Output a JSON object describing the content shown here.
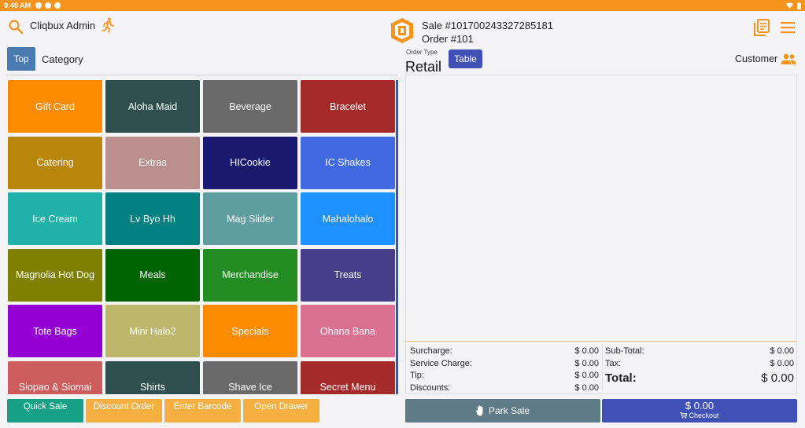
{
  "status": {
    "time": "9:48 AM"
  },
  "header": {
    "user_name": "Cliqbux Admin",
    "sale_number": "Sale #101700243327285181",
    "order_number": "Order #101"
  },
  "categories": {
    "top_label": "Top",
    "title": "Category",
    "tiles": [
      {
        "label": "Gift Card",
        "color": "#ff8c00"
      },
      {
        "label": "Aloha Maid",
        "color": "#2f4f4f"
      },
      {
        "label": "Beverage",
        "color": "#696969"
      },
      {
        "label": "Bracelet",
        "color": "#a52a2a"
      },
      {
        "label": "Catering",
        "color": "#b8860b"
      },
      {
        "label": "Extras",
        "color": "#bc8f8f"
      },
      {
        "label": "HICookie",
        "color": "#191970"
      },
      {
        "label": "IC Shakes",
        "color": "#4169e1"
      },
      {
        "label": "Ice Cream",
        "color": "#20b2aa"
      },
      {
        "label": "Lv Byo Hh",
        "color": "#008080"
      },
      {
        "label": "Mag Slider",
        "color": "#5f9ea0"
      },
      {
        "label": "Mahalohalo",
        "color": "#1e90ff"
      },
      {
        "label": "Magnolia Hot Dog",
        "color": "#808000"
      },
      {
        "label": "Meals",
        "color": "#006400"
      },
      {
        "label": "Merchandise",
        "color": "#228b22"
      },
      {
        "label": "Treats",
        "color": "#483d8b"
      },
      {
        "label": "Tote Bags",
        "color": "#9400d3"
      },
      {
        "label": "Mini Halo2",
        "color": "#bdb76b"
      },
      {
        "label": "Specials",
        "color": "#ff8c00"
      },
      {
        "label": "Ohana Bana",
        "color": "#db7093"
      },
      {
        "label": "Siopao & Siomai",
        "color": "#cd5c5c"
      },
      {
        "label": "Shirts",
        "color": "#2f4f4f"
      },
      {
        "label": "Shave Ice",
        "color": "#696969"
      },
      {
        "label": "Secret Menu",
        "color": "#a52a2a"
      }
    ]
  },
  "bottom_actions": [
    {
      "label": "Quick Sale",
      "color": "#16a085"
    },
    {
      "label": "Discount Order",
      "color": "#f5b041"
    },
    {
      "label": "Enter Barcode",
      "color": "#f5b041"
    },
    {
      "label": "Open Drawer",
      "color": "#f5b041"
    }
  ],
  "order": {
    "order_type_label": "Order Type",
    "order_type_value": "Retail",
    "table_button": "Table",
    "customer_label": "Customer"
  },
  "totals": {
    "surcharge_label": "Surcharge:",
    "surcharge": "$ 0.00",
    "service_label": "Service Charge:",
    "service": "$ 0.00",
    "tip_label": "Tip:",
    "tip": "$ 0.00",
    "discounts_label": "Discounts:",
    "discounts": "$ 0.00",
    "subtotal_label": "Sub-Total:",
    "subtotal": "$ 0.00",
    "tax_label": "Tax:",
    "tax": "$ 0.00",
    "total_label": "Total:",
    "total": "$ 0.00"
  },
  "actions": {
    "park_label": "Park Sale",
    "checkout_amount": "$ 0.00",
    "checkout_label": "Checkout"
  },
  "colors": {
    "accent": "#f7941d",
    "primary": "#3f51b5",
    "park": "#5f7b87"
  }
}
